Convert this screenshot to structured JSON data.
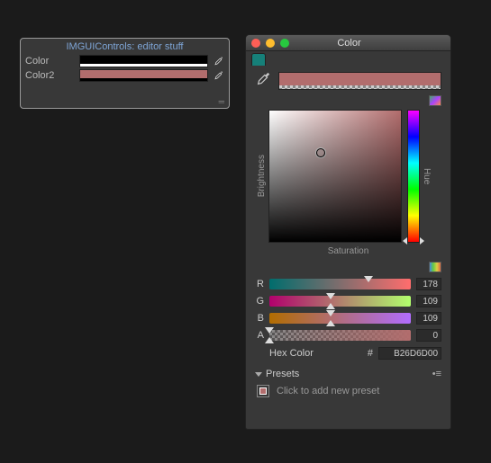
{
  "inspector": {
    "title": "IMGUIControls: editor stuff",
    "fields": [
      {
        "label": "Color",
        "rgb": "#000000",
        "alpha": 1
      },
      {
        "label": "Color2",
        "rgb": "#b26d6d",
        "alpha": 0
      }
    ]
  },
  "picker": {
    "window_title": "Color",
    "axes": {
      "brightness": "Brightness",
      "saturation": "Saturation",
      "hue": "Hue"
    },
    "sv_cursor": {
      "x_pct": 39,
      "y_pct": 32
    },
    "hue_pos_pct": 99,
    "sliders": {
      "r": {
        "label": "R",
        "value": 178,
        "pos_pct": 70
      },
      "g": {
        "label": "G",
        "value": 109,
        "pos_pct": 43
      },
      "b": {
        "label": "B",
        "value": 109,
        "pos_pct": 43
      },
      "a": {
        "label": "A",
        "value": 0,
        "pos_pct": 0
      }
    },
    "hex": {
      "label": "Hex Color",
      "hash": "#",
      "value": "B26D6D00"
    },
    "presets": {
      "heading": "Presets",
      "hint": "Click to add new preset"
    },
    "preview_color": "#b26d6d"
  }
}
